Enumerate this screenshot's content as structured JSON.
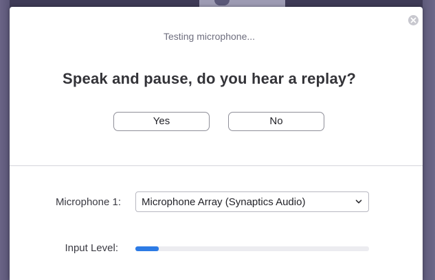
{
  "dialog": {
    "status_text": "Testing microphone...",
    "question": "Speak and pause, do you hear a replay?",
    "yes_label": "Yes",
    "no_label": "No",
    "close_icon": "close-icon"
  },
  "microphone": {
    "label": "Microphone 1:",
    "selected": "Microphone Array (Synaptics Audio)",
    "dropdown_icon": "chevron-down-icon"
  },
  "input_level": {
    "label": "Input Level:",
    "level": 0.1
  },
  "colors": {
    "accent": "#2d7be5",
    "dialog_bg": "#ffffff",
    "backdrop": "#4b4767"
  }
}
